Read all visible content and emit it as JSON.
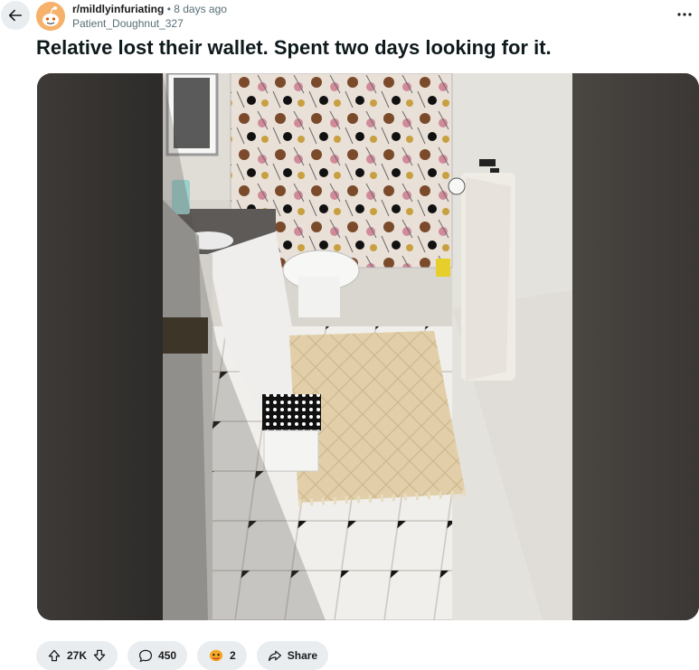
{
  "post": {
    "subreddit": "r/mildlyinfuriating",
    "separator": "•",
    "time_ago": "8 days ago",
    "author": "Patient_Doughnut_327",
    "title": "Relative lost their wallet. Spent two days looking for it."
  },
  "actions": {
    "upvotes": "27K",
    "comments": "450",
    "awards": "2",
    "share_label": "Share"
  },
  "icons": {
    "back": "arrow-left-icon",
    "more": "more-horizontal-icon",
    "upvote": "upvote-arrow-icon",
    "downvote": "downvote-arrow-icon",
    "comment": "comment-bubble-icon",
    "award": "award-icon",
    "share": "share-arrow-icon"
  },
  "colors": {
    "pill_bg": "#eaedef",
    "meta_text": "#576f76",
    "title_text": "#0f1a1c",
    "avatar_bg": "#f6b26b"
  }
}
